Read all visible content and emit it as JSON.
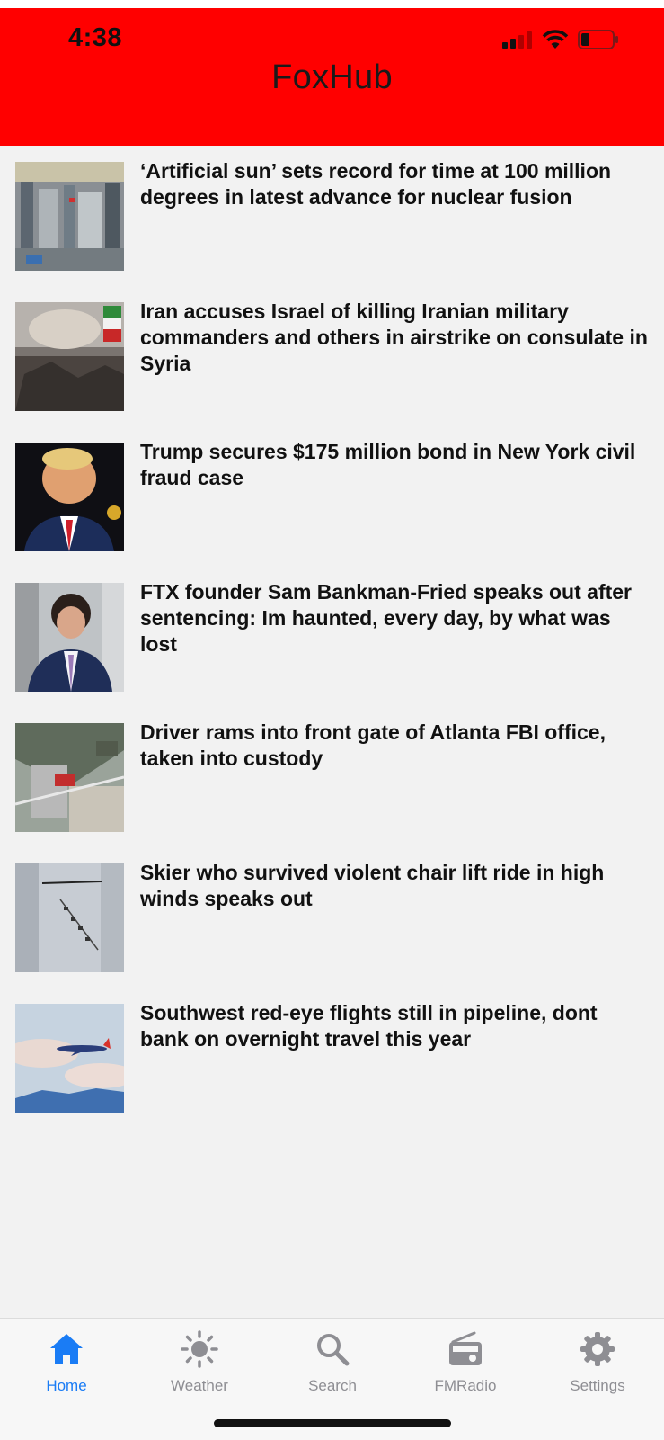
{
  "status_bar": {
    "time": "4:38"
  },
  "app": {
    "title": "FoxHub"
  },
  "news": [
    {
      "headline": "‘Artificial sun’ sets record for time at 100 million degrees in latest advance for nuclear fusion",
      "thumb_icon": "fusion-reactor-photo"
    },
    {
      "headline": "Iran accuses Israel of killing Iranian military commanders and others in airstrike on consulate in Syria",
      "thumb_icon": "airstrike-rubble-photo"
    },
    {
      "headline": "Trump secures $175 million bond in New York civil fraud case",
      "thumb_icon": "portrait-photo"
    },
    {
      "headline": "FTX founder Sam Bankman-Fried speaks out after sentencing: Im haunted, every day, by what was lost",
      "thumb_icon": "portrait-photo"
    },
    {
      "headline": "Driver rams into front gate of Atlanta FBI office, taken into custody",
      "thumb_icon": "aerial-photo"
    },
    {
      "headline": "Skier who survived violent chair lift ride in high winds speaks out",
      "thumb_icon": "chairlift-photo"
    },
    {
      "headline": "Southwest red-eye flights still in pipeline, dont bank on overnight travel this year",
      "thumb_icon": "airplane-photo"
    }
  ],
  "tabs": [
    {
      "label": "Home",
      "icon": "house-icon",
      "active": true
    },
    {
      "label": "Weather",
      "icon": "sun-icon",
      "active": false
    },
    {
      "label": "Search",
      "icon": "magnifier-icon",
      "active": false
    },
    {
      "label": "FMRadio",
      "icon": "radio-icon",
      "active": false
    },
    {
      "label": "Settings",
      "icon": "gear-icon",
      "active": false
    }
  ],
  "colors": {
    "header_bg": "#ff0000",
    "tab_active": "#1a7cf5",
    "tab_inactive": "#8e8e93",
    "page_bg": "#f2f2f2"
  }
}
